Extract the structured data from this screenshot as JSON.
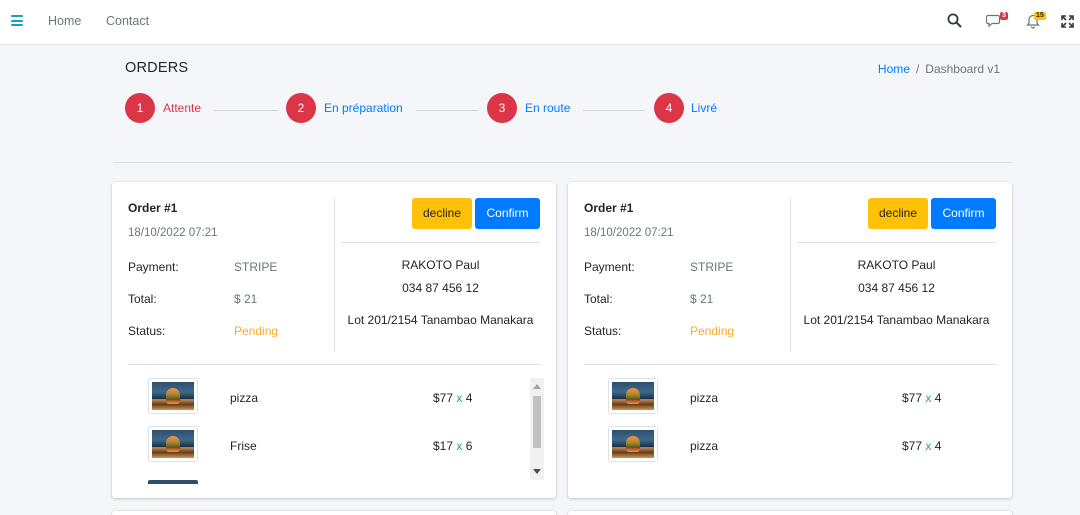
{
  "navbar": {
    "links": [
      "Home",
      "Contact"
    ],
    "icons": [
      "menu-icon",
      "search-icon",
      "messages-icon",
      "notifications-icon",
      "fullscreen-icon"
    ],
    "messages_badge": "3",
    "notifications_badge": "15"
  },
  "page": {
    "title": "ORDERS",
    "breadcrumb": {
      "home": "Home",
      "separator": "/",
      "current": "Dashboard v1"
    }
  },
  "steps": [
    {
      "number": "1",
      "label": "Attente"
    },
    {
      "number": "2",
      "label": "En préparation"
    },
    {
      "number": "3",
      "label": "En route"
    },
    {
      "number": "4",
      "label": "Livré"
    }
  ],
  "orders": [
    {
      "title": "Order #1",
      "date": "18/10/2022 07:21",
      "payment_label": "Payment:",
      "payment": "STRIPE",
      "total_label": "Total:",
      "total": "$ 21",
      "status_label": "Status:",
      "status": "Pending",
      "decline_label": "decline",
      "confirm_label": "Confirm",
      "customer": {
        "name": "RAKOTO Paul",
        "phone": "034 87 456 12",
        "address": "Lot 201/2154 Tanambao Manakara"
      },
      "items": [
        {
          "name": "pizza",
          "price": "$77",
          "x": "x",
          "qty": "4"
        },
        {
          "name": "Frise",
          "price": "$17",
          "x": "x",
          "qty": "6"
        }
      ]
    },
    {
      "title": "Order #1",
      "date": "18/10/2022 07:21",
      "payment_label": "Payment:",
      "payment": "STRIPE",
      "total_label": "Total:",
      "total": "$ 21",
      "status_label": "Status:",
      "status": "Pending",
      "decline_label": "decline",
      "confirm_label": "Confirm",
      "customer": {
        "name": "RAKOTO Paul",
        "phone": "034 87 456 12",
        "address": "Lot 201/2154 Tanambao Manakara"
      },
      "items": [
        {
          "name": "pizza",
          "price": "$77",
          "x": "x",
          "qty": "4"
        },
        {
          "name": "pizza",
          "price": "$77",
          "x": "x",
          "qty": "4"
        }
      ]
    }
  ],
  "colors": {
    "primary": "#007bff",
    "warning": "#ffc107",
    "danger": "#dc3545",
    "info": "#17a2b8",
    "pending": "#ffa726"
  }
}
